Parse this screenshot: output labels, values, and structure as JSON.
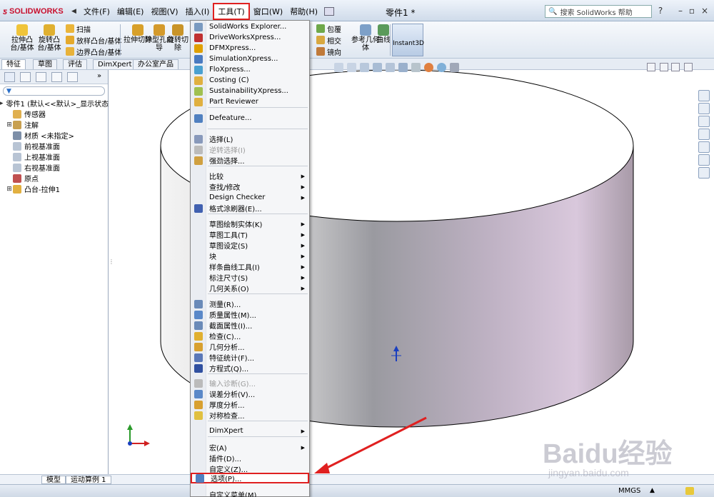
{
  "app": {
    "logo": "SOLIDWORKS",
    "document_title": "零件1 *",
    "help_search_placeholder": "搜索 SolidWorks 帮助"
  },
  "menubar": {
    "items": [
      "文件(F)",
      "编辑(E)",
      "视图(V)",
      "插入(I)",
      "工具(T)",
      "窗口(W)",
      "帮助(H)"
    ],
    "active": "工具(T)"
  },
  "command_manager": {
    "extrude_boss": "拉伸凸台/基体",
    "revolve_boss": "旋转凸台/基体",
    "sweep": "扫描",
    "loft_boss": "放样凸台/基体",
    "boundary_boss": "边界凸台/基体",
    "extrude_cut": "拉伸切除",
    "hole_wizard": "异型孔向导",
    "revolve_cut": "旋转切除",
    "wrap": "包覆",
    "intersect": "相交",
    "mirror": "镜向",
    "reference_geometry": "参考几何体",
    "curves": "曲线",
    "instant3d": "Instant3D",
    "tabs": [
      "特征",
      "草图",
      "评估",
      "DimXpert",
      "办公室产品"
    ]
  },
  "feature_tree": {
    "root": "零件1 (默认<<默认>_显示状态",
    "items": [
      {
        "label": "传感器",
        "expandable": false
      },
      {
        "label": "注解",
        "expandable": true
      },
      {
        "label": "材质 <未指定>",
        "expandable": false
      },
      {
        "label": "前视基准面",
        "expandable": false
      },
      {
        "label": "上视基准面",
        "expandable": false
      },
      {
        "label": "右视基准面",
        "expandable": false
      },
      {
        "label": "原点",
        "expandable": false
      },
      {
        "label": "凸台-拉伸1",
        "expandable": true
      }
    ]
  },
  "tools_menu": {
    "items": [
      {
        "label": "SolidWorks Explorer...",
        "submenu": false,
        "disabled": false
      },
      {
        "label": "DriveWorksXpress...",
        "submenu": false,
        "disabled": false
      },
      {
        "label": "DFMXpress...",
        "submenu": false,
        "disabled": false
      },
      {
        "label": "SimulationXpress...",
        "submenu": false,
        "disabled": false
      },
      {
        "label": "FloXpress...",
        "submenu": false,
        "disabled": false
      },
      {
        "label": "Costing (C)",
        "submenu": false,
        "disabled": false
      },
      {
        "label": "SustainabilityXpress...",
        "submenu": false,
        "disabled": false
      },
      {
        "label": "Part Reviewer",
        "submenu": false,
        "disabled": false
      },
      {
        "label": "Defeature...",
        "submenu": false,
        "disabled": false
      },
      {
        "label": "选择(L)",
        "submenu": false,
        "disabled": false
      },
      {
        "label": "逆转选择(I)",
        "submenu": false,
        "disabled": true
      },
      {
        "label": "强劲选择...",
        "submenu": false,
        "disabled": false
      },
      {
        "label": "比较",
        "submenu": true,
        "disabled": false
      },
      {
        "label": "查找/修改",
        "submenu": true,
        "disabled": false
      },
      {
        "label": "Design Checker",
        "submenu": true,
        "disabled": false
      },
      {
        "label": "格式涂刷器(E)...",
        "submenu": false,
        "disabled": false
      },
      {
        "label": "草图绘制实体(K)",
        "submenu": true,
        "disabled": false
      },
      {
        "label": "草图工具(T)",
        "submenu": true,
        "disabled": false
      },
      {
        "label": "草图设定(S)",
        "submenu": true,
        "disabled": false
      },
      {
        "label": "块",
        "submenu": true,
        "disabled": false
      },
      {
        "label": "样条曲线工具(I)",
        "submenu": true,
        "disabled": false
      },
      {
        "label": "标注尺寸(S)",
        "submenu": true,
        "disabled": false
      },
      {
        "label": "几何关系(O)",
        "submenu": true,
        "disabled": false
      },
      {
        "label": "测量(R)...",
        "submenu": false,
        "disabled": false
      },
      {
        "label": "质量属性(M)...",
        "submenu": false,
        "disabled": false
      },
      {
        "label": "截面属性(I)...",
        "submenu": false,
        "disabled": false
      },
      {
        "label": "检查(C)...",
        "submenu": false,
        "disabled": false
      },
      {
        "label": "几何分析...",
        "submenu": false,
        "disabled": false
      },
      {
        "label": "特征统计(F)...",
        "submenu": false,
        "disabled": false
      },
      {
        "label": "方程式(Q)...",
        "submenu": false,
        "disabled": false
      },
      {
        "label": "输入诊断(G)...",
        "submenu": false,
        "disabled": true
      },
      {
        "label": "误差分析(V)...",
        "submenu": false,
        "disabled": false
      },
      {
        "label": "厚度分析...",
        "submenu": false,
        "disabled": false
      },
      {
        "label": "对称检查...",
        "submenu": false,
        "disabled": false
      },
      {
        "label": "DimXpert",
        "submenu": true,
        "disabled": false
      },
      {
        "label": "宏(A)",
        "submenu": true,
        "disabled": false
      },
      {
        "label": "插件(D)...",
        "submenu": false,
        "disabled": false
      },
      {
        "label": "自定义(Z)...",
        "submenu": false,
        "disabled": false
      },
      {
        "label": "选项(P)...",
        "submenu": false,
        "disabled": false
      },
      {
        "label": "自定义菜单(M)",
        "submenu": false,
        "disabled": false
      }
    ],
    "highlighted": "选项(P)..."
  },
  "bottom_tabs": [
    "模型",
    "运动算例 1"
  ],
  "status": {
    "units": "MMGS"
  },
  "watermark": {
    "logo": "Baidu经验",
    "url": "jingyan.baidu.com"
  },
  "colors": {
    "highlight_box": "#e02020",
    "annotation_arrow": "#e02020",
    "body_shade": "#c8b8cc"
  }
}
